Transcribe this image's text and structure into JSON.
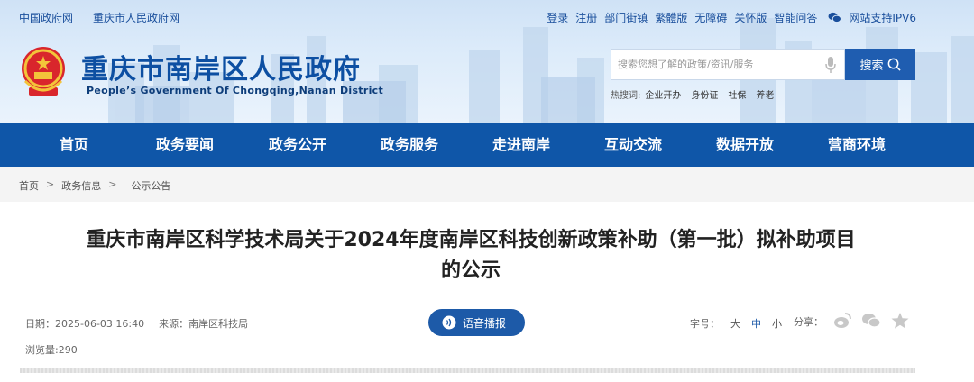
{
  "topbar": {
    "left_links": [
      "中国政府网",
      "重庆市人民政府网"
    ],
    "right_links": [
      "登录",
      "注册",
      "部门街镇",
      "繁體版",
      "无障碍",
      "关怀版",
      "智能问答"
    ],
    "ipv6": "网站支持IPV6"
  },
  "site": {
    "title": "重庆市南岸区人民政府",
    "subtitle": "People’s Government Of Chongqing,Nanan District"
  },
  "search": {
    "placeholder": "搜索您想了解的政策/资讯/服务",
    "button_label": "搜索",
    "hot_label": "热搜词:",
    "hot_words": [
      "企业开办",
      "身份证",
      "社保",
      "养老"
    ]
  },
  "nav": {
    "items": [
      "首页",
      "政务要闻",
      "政务公开",
      "政务服务",
      "走进南岸",
      "互动交流",
      "数据开放",
      "营商环境"
    ]
  },
  "breadcrumb": {
    "items": [
      "首页",
      "政务信息",
      "公示公告"
    ],
    "separator": ">"
  },
  "article": {
    "title_line1": "重庆市南岸区科学技术局关于2024年度南岸区科技创新政策补助（第一批）拟补助项目",
    "title_line2": "的公示",
    "date_text": "日期：2025-06-03 16:40",
    "source_text": "来源：南岸区科技局",
    "views_text": "浏览量:290",
    "audio_label": "语音播报",
    "font_size_label": "字号：",
    "font_sizes": [
      "大",
      "中",
      "小"
    ],
    "share_label": "分享："
  },
  "colors": {
    "brand_blue": "#0f56a8",
    "title_blue": "#0d4fa2"
  }
}
